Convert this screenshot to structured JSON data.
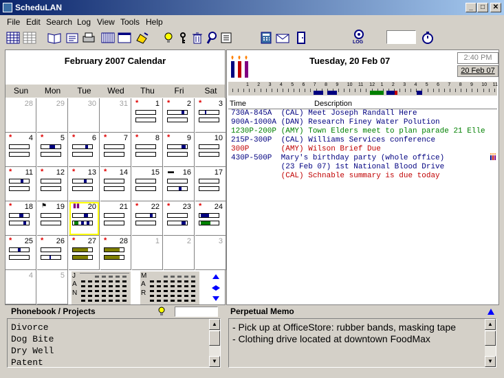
{
  "window": {
    "title": "ScheduLAN",
    "min": "_",
    "max": "□",
    "close": "✕"
  },
  "menu": [
    "File",
    "Edit",
    "Search",
    "Log",
    "View",
    "Tools",
    "Help"
  ],
  "toolbar": {
    "log_label": "LOG"
  },
  "calendar": {
    "title": "February 2007 Calendar",
    "dow": [
      "Sun",
      "Mon",
      "Tue",
      "Wed",
      "Thu",
      "Fri",
      "Sat"
    ],
    "weeks": [
      [
        {
          "d": "28",
          "o": true
        },
        {
          "d": "29",
          "o": true
        },
        {
          "d": "30",
          "o": true
        },
        {
          "d": "31",
          "o": true
        },
        {
          "d": "1",
          "s": true,
          "b": 1
        },
        {
          "d": "2",
          "s": true,
          "b": 1
        },
        {
          "d": "3",
          "s": true,
          "b": 1
        }
      ],
      [
        {
          "d": "4",
          "s": true,
          "b": 1
        },
        {
          "d": "5",
          "s": true,
          "b": 1
        },
        {
          "d": "6",
          "s": true,
          "b": 1
        },
        {
          "d": "7",
          "s": true,
          "b": 1
        },
        {
          "d": "8",
          "s": true,
          "b": 1
        },
        {
          "d": "9",
          "s": true,
          "b": 1
        },
        {
          "d": "10",
          "b": 1
        }
      ],
      [
        {
          "d": "11",
          "s": true,
          "b": 1
        },
        {
          "d": "12",
          "s": true,
          "b": 1
        },
        {
          "d": "13",
          "s": true,
          "b": 1
        },
        {
          "d": "14",
          "s": true,
          "b": 1
        },
        {
          "d": "15",
          "b": 1
        },
        {
          "d": "16",
          "b": 1
        },
        {
          "d": "17",
          "b": 1
        }
      ],
      [
        {
          "d": "18",
          "s": true,
          "b": 1
        },
        {
          "d": "19",
          "b": 1
        },
        {
          "d": "20",
          "b": 1,
          "sel": true
        },
        {
          "d": "21",
          "b": 1
        },
        {
          "d": "22",
          "s": true,
          "b": 1
        },
        {
          "d": "23",
          "s": true,
          "b": 1
        },
        {
          "d": "24",
          "s": true,
          "b": 1
        }
      ],
      [
        {
          "d": "25",
          "s": true,
          "b": 1
        },
        {
          "d": "26",
          "s": true,
          "b": 1
        },
        {
          "d": "27",
          "s": true,
          "b": 1
        },
        {
          "d": "28",
          "s": true,
          "b": 1
        },
        {
          "d": "1",
          "o": true
        },
        {
          "d": "2",
          "o": true
        },
        {
          "d": "3",
          "o": true
        }
      ],
      [
        {
          "d": "4",
          "o": true
        },
        {
          "d": "5",
          "o": true
        }
      ]
    ],
    "mini_jan_letters": [
      "J",
      "A",
      "N"
    ],
    "mini_mar_letters": [
      "M",
      "A",
      "R"
    ]
  },
  "day": {
    "title": "Tuesday, 20 Feb 07",
    "time": "2:40 PM",
    "date": "20 Feb 07",
    "hours": [
      "1",
      "2",
      "3",
      "4",
      "5",
      "6",
      "7",
      "8",
      "9",
      "10",
      "11",
      "12",
      "1",
      "2",
      "3",
      "4",
      "5",
      "6",
      "7",
      "8",
      "9",
      "10",
      "11"
    ],
    "col_time": "Time",
    "col_desc": "Description",
    "appointments": [
      {
        "text": "730A-845A  (CAL) Meet Joseph Randall Here",
        "color": "#000080"
      },
      {
        "text": "900A-1000A (DAN) Research Finey Water Polution",
        "color": "#000080"
      },
      {
        "text": "1230P-200P (AMY) Town Elders meet to plan parade 21 Elle",
        "color": "#008000"
      },
      {
        "text": "215P-300P  (CAL) Williams Services conference",
        "color": "#000080"
      },
      {
        "text": "300P       (AMY) Wilson Brief Due",
        "color": "#c00000"
      },
      {
        "text": "430P-500P  Mary's birthday party (whole office)",
        "color": "#000080"
      },
      {
        "text": "           (23 Feb 07) 1st National Blood Drive",
        "color": "#000080"
      },
      {
        "text": "           (CAL) Schnable summary is due today",
        "color": "#c00000"
      }
    ]
  },
  "phonebook": {
    "title": "Phonebook / Projects",
    "search": "",
    "items": [
      "Divorce",
      "Dog Bite",
      "Dry Well",
      "Patent"
    ]
  },
  "memo": {
    "title": "Perpetual Memo",
    "lines": [
      "- Pick up at OfficeStore:  rubber bands, masking tape",
      "- Clothing drive located at downtown FoodMax"
    ]
  },
  "colors": {
    "blue_bar": "#000080",
    "green_bar": "#008000",
    "olive_bar": "#808000",
    "selected": "#ffff00",
    "red": "#e00000"
  }
}
